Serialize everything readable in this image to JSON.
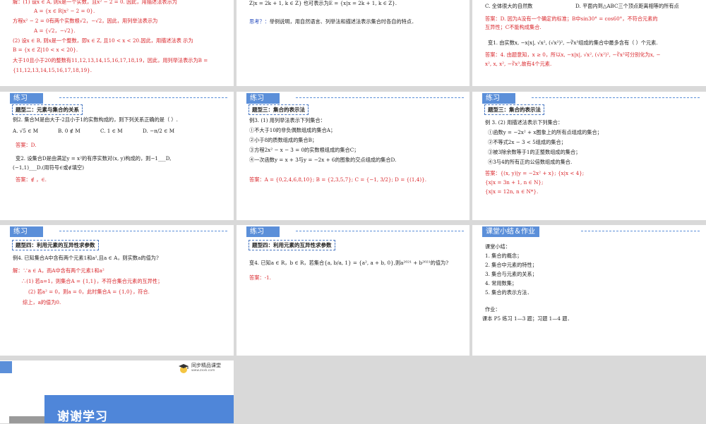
{
  "slides": {
    "s1": {
      "lines": [
        "解：(1) 设x ∈ A, 则x是一个实数，且x² − 2 = 0. 因此，用描述法表示为",
        "A = {x ∈ R|x² − 2 = 0}.",
        "方程x² − 2 = 0有两个实数根√2，−√2，因此，用列举法表示为",
        "A = {√2，−√2}.",
        "(2) 设x ∈ B, 则x是一个整数，即x ∈ Z, 且10 < x < 20.因此，用描述法表   示为",
        "B = {x ∈ Z|10 < x < 20}.",
        "大于10且小于20的整数有11,12,13,14,15,16,17,18,19，因此，用列举法表示为B =",
        "{11,12,13,14,15,16,17,18,19}."
      ]
    },
    "s2": {
      "line1": "Z|x = 2k + 1, k ∈ Z} 也可表示为E = {x|x = 2k + 1, k ∈ Z}.",
      "think_label": "思考？：",
      "think_text": "举例说明，用自然语言、列举法和描述法表示集合时各自的特点．"
    },
    "s3": {
      "optC": "C. 全体很大的自然数",
      "optD": "D. 平面内到△ABC三个顶点距离相等的所有点",
      "ans1": "答案：D. 因为A没有一个确定的标准；B中sin30° = cos60°，不符合元素的",
      "ans2": "互异性；C不能构成集合.",
      "q1": "变1. 由实数x, −x|x|, √x², (√x²)², −∛x³组成的集合中最多含有（    ）个元素.",
      "a1": "答案：4. 由题意知，x ≥ 0，所以x, −x|x|, √x², (√x²)², −∛x³可分别化为x, −",
      "a2": "x², x, x², −∛x³,故有4个元素."
    },
    "s4": {
      "header": "练习",
      "tag": "题型二：元素与集合的关系",
      "q": "例2. 集合M是由大于-2且小于1的实数构成的，则下列关系正确的是（ ）.",
      "optA": "A. √5 ∈ M",
      "optB": "B. 0 ∉ M",
      "optC": "C. 1 ∈ M",
      "optD": "D. −π/2 ∈ M",
      "ans": "答案：",
      "ans_val": "D.",
      "q2a": "变2. 设集合D是由满足y = x²的有序实数对(x, y)构成的，则−1___D,",
      "q2b": "(−1,1)___D.(用符号∈或∉填空)",
      "ans2": "答案：∉ ，∈."
    },
    "s5": {
      "header": "练习",
      "tag": "题型三：集合的表示法",
      "q": "例3. (1) 用列举法表示下列集合：",
      "items": [
        "①不大于10的非负偶数组成的集合A；",
        "②小于8的质数组成的集合B；",
        "③方程2x² − x − 3 = 0的实数根组成的集合C；",
        "④一次函数y = x + 3与y = −2x + 6的图象的交点组成的集合D."
      ],
      "ans": "答案：A = {0,2,4,6,8,10}; B = {2,3,5,7}; C = {−1, 3/2}; D = {(1,4)}."
    },
    "s6": {
      "header": "练习",
      "tag": "题型三：集合的表示法",
      "q": "例 3. (2) 用描述法表示下列集合：",
      "items": [
        "①函数y = −2x² + x图象上的所有点组成的集合；",
        "②不等式2x − 3 < 5组成的集合；",
        "③被3除余数等于1的正整数组成的集合；",
        "④3与4的所有正的公倍数组成的集合."
      ],
      "ans": [
        "答案：{(x, y)|y = −2x² + x}; {x|x < 4};",
        "{x|x = 3n + 1, n ∈ N};",
        "{x|x = 12n, n ∈ N*}."
      ]
    },
    "s7": {
      "header": "练习",
      "tag": "题型四：利用元素的互异性求参数",
      "q": "例4. 已知集合A中含有两个元素1和a²,且a ∈ A，则实数a的值为?",
      "sol": [
        "解：∵a ∈ A，而A中含有两个元素1和a²",
        "∴(1) 若a=1，则集合A = {1,1}，不符合集合元素的互异性；",
        "(2) 若a² = 0，则a = 0，此时集合A = {1,0}，符合.",
        "综上，a的值为0."
      ]
    },
    "s8": {
      "header": "练习",
      "tag": "题型四：利用元素的互异性求参数",
      "q": "变4. 已知a ∈ R，b ∈ R，若集合{a, b/a, 1} = {a², a + b, 0},则a²⁰²¹ + b²⁰²¹的值为?",
      "ans": "答案：-1."
    },
    "s9": {
      "header": "课堂小结＆作业",
      "title": "课堂小结：",
      "items": [
        "1. 集合的概念；",
        "2. 集合中元素的特性；",
        "3. 集合与元素的关系；",
        "4. 常用数集；",
        "5. 集合的表示方法．"
      ],
      "hw_title": "作业：",
      "hw": "课本 P5 练习 1—3 题；习题 1—4 题．"
    },
    "s10": {
      "thanks": "谢谢学习",
      "logo_name": "同步精品课堂",
      "logo_url": "www.zxxk.com"
    }
  },
  "colors": {
    "accent": "#5b8fd9",
    "answer": "#d9262b",
    "gray": "#d9d9d9"
  }
}
